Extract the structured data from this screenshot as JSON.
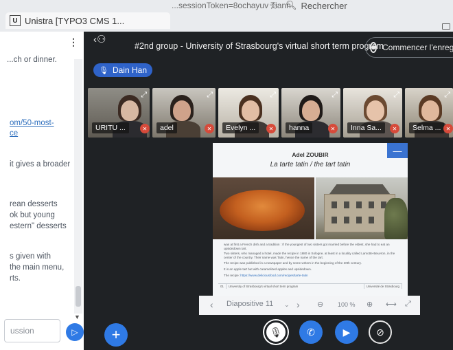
{
  "browser": {
    "tab_icon_letter": "U",
    "tab_title": "Unistra [TYPO3 CMS 1...",
    "url_fragment": "...sessionToken=8ochayuv Tiann",
    "search_placeholder": "Rechercher",
    "search_icon": "magnifier-icon",
    "bookmark_icon": "star-icon"
  },
  "chat": {
    "lines": [
      "...ch or dinner.",
      "om/50-most-",
      "ce",
      "it gives a broader",
      "rean desserts",
      "ok but young",
      "estern\" desserts",
      "s given with",
      " the main menu,",
      "rts."
    ],
    "input_placeholder": "ussion",
    "send_icon": "send-icon"
  },
  "meeting": {
    "title": "#2nd group - University of Strasbourg's virtual short term program",
    "record_label": "Commencer l'enregistrement",
    "talking_user": "Dain Han"
  },
  "participants": [
    {
      "name": "URITU ..."
    },
    {
      "name": "adel"
    },
    {
      "name": "Evelyn ..."
    },
    {
      "name": "hanna"
    },
    {
      "name": "Inna Sa..."
    },
    {
      "name": "Selma ..."
    }
  ],
  "slide": {
    "author": "Adel ZOUBIR",
    "title": "La tarte tatin / the tart tatin",
    "paragraphs": [
      "was at first a French dish and a tradition : If the youngest of two sisters got married before the eldest, she had to eat an upsidedown tart.",
      "Two sisters, who managed a hotel, made the recipe in 1880 in Sologne, at least in a locality called Lamotte-Beuvron, in the center of the country. Their name was Tatin, hence the name of the tart.",
      "The recipe was published in a newspaper and by some writers in the beginning of the 20th century.",
      "It is an apple tart but with caramelized apples and upsidedown.",
      "The recipe:"
    ],
    "recipe_link": "https://www.deliciousfood.com/recipes/tarte-tatin",
    "footer": [
      "01",
      "University of Strasbourg's virtual short term program",
      "Université de Strasbourg"
    ]
  },
  "slide_toolbar": {
    "slide_label": "Diapositive 11",
    "zoom": "100 %"
  },
  "colors": {
    "accent": "#2f7ae5",
    "talker_badge": "#2f63c9",
    "mute_badge": "#d64a3a"
  }
}
